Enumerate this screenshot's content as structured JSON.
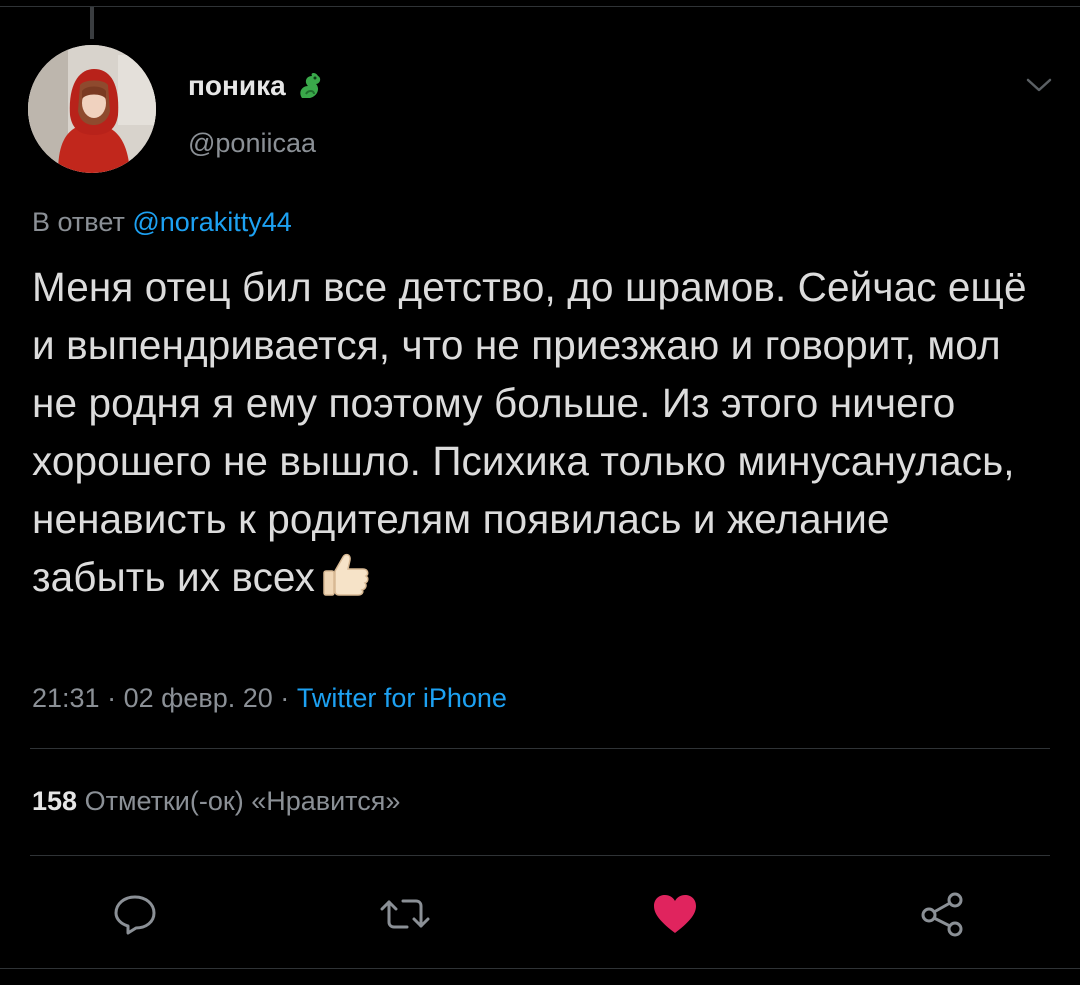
{
  "author": {
    "display_name": "поника",
    "handle": "@poniicaa",
    "badge_icon": "dragon-emoji-icon",
    "avatar_icon": "profile-photo-avatar"
  },
  "reply": {
    "prefix": "В ответ",
    "mention": "@norakitty44"
  },
  "tweet": {
    "text": "Меня отец бил все детство, до шрамов. Сейчас ещё и выпендривается, что не приезжаю и говорит, мол не родня я ему поэтому больше. Из этого ничего хорошего не вышло. Психика только минусанулась, ненависть к родителям появилась и желание забыть их всех",
    "trailing_emoji": "thumbs-up-icon"
  },
  "meta": {
    "time": "21:31",
    "date": "02 февр. 20",
    "separator": "·",
    "source": "Twitter for iPhone"
  },
  "stats": {
    "likes_count": "158",
    "likes_label": "Отметки(-ок) «Нравится»"
  },
  "actions": [
    {
      "name": "reply",
      "icon": "comment-icon"
    },
    {
      "name": "retweet",
      "icon": "retweet-icon"
    },
    {
      "name": "like",
      "icon": "heart-icon",
      "active": true
    },
    {
      "name": "share",
      "icon": "share-icon"
    }
  ],
  "colors": {
    "background": "#000000",
    "link": "#1da1f2",
    "like_active": "#e0245e",
    "secondary_text": "#8b9096"
  }
}
